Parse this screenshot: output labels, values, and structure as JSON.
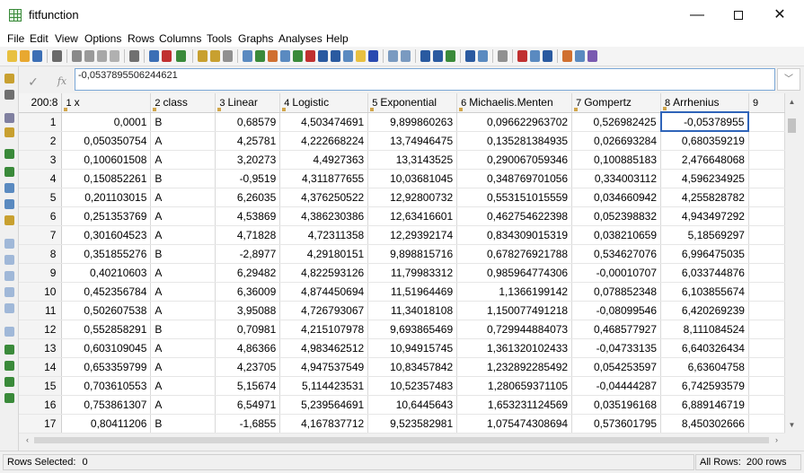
{
  "window": {
    "title": "fitfunction",
    "min_glyph": "—",
    "close_glyph": "✕"
  },
  "menu": [
    "File",
    "Edit",
    "View",
    "Options",
    "Rows",
    "Columns",
    "Tools",
    "Graphs",
    "Analyses",
    "Help"
  ],
  "formula_bar": {
    "cancel_glyph": "✓",
    "fx_label": "fx",
    "value": "-0,0537895506244621",
    "dropdown_glyph": "﹀"
  },
  "grid": {
    "corner_label": "200:8",
    "columns": [
      {
        "num": "1",
        "name": "x"
      },
      {
        "num": "2",
        "name": "class"
      },
      {
        "num": "3",
        "name": "Linear"
      },
      {
        "num": "4",
        "name": "Logistic"
      },
      {
        "num": "5",
        "name": "Exponential"
      },
      {
        "num": "6",
        "name": "Michaelis.Menten"
      },
      {
        "num": "7",
        "name": "Gompertz"
      },
      {
        "num": "8",
        "name": "Arrhenius"
      },
      {
        "num": "9",
        "name": ""
      }
    ],
    "rows": [
      [
        "1",
        "0,0001",
        "B",
        "0,68579",
        "4,503474691",
        "9,899860263",
        "0,096622963702",
        "0,526982425",
        "-0,05378955"
      ],
      [
        "2",
        "0,050350754",
        "A",
        "4,25781",
        "4,222668224",
        "13,74946475",
        "0,135281384935",
        "0,026693284",
        "0,680359219"
      ],
      [
        "3",
        "0,100601508",
        "A",
        "3,20273",
        "4,4927363",
        "13,3143525",
        "0,290067059346",
        "0,100885183",
        "2,476648068"
      ],
      [
        "4",
        "0,150852261",
        "B",
        "-0,9519",
        "4,311877655",
        "10,03681045",
        "0,348769701056",
        "0,334003112",
        "4,596234925"
      ],
      [
        "5",
        "0,201103015",
        "A",
        "6,26035",
        "4,376250522",
        "12,92800732",
        "0,553151015559",
        "0,034660942",
        "4,255828782"
      ],
      [
        "6",
        "0,251353769",
        "A",
        "4,53869",
        "4,386230386",
        "12,63416601",
        "0,462754622398",
        "0,052398832",
        "4,943497292"
      ],
      [
        "7",
        "0,301604523",
        "A",
        "4,71828",
        "4,72311358",
        "12,29392174",
        "0,834309015319",
        "0,038210659",
        "5,18569297"
      ],
      [
        "8",
        "0,351855276",
        "B",
        "-2,8977",
        "4,29180151",
        "9,898815716",
        "0,678276921788",
        "0,534627076",
        "6,996475035"
      ],
      [
        "9",
        "0,40210603",
        "A",
        "6,29482",
        "4,822593126",
        "11,79983312",
        "0,985964774306",
        "-0,00010707",
        "6,033744876"
      ],
      [
        "10",
        "0,452356784",
        "A",
        "6,36009",
        "4,874450694",
        "11,51964469",
        "1,1366199142",
        "0,078852348",
        "6,103855674"
      ],
      [
        "11",
        "0,502607538",
        "A",
        "3,95088",
        "4,726793067",
        "11,34018108",
        "1,150077491218",
        "-0,08099546",
        "6,420269239"
      ],
      [
        "12",
        "0,552858291",
        "B",
        "0,70981",
        "4,215107978",
        "9,693865469",
        "0,729944884073",
        "0,468577927",
        "8,111084524"
      ],
      [
        "13",
        "0,603109045",
        "A",
        "4,86366",
        "4,983462512",
        "10,94915745",
        "1,361320102433",
        "-0,04733135",
        "6,640326434"
      ],
      [
        "14",
        "0,653359799",
        "A",
        "4,23705",
        "4,947537549",
        "10,83457842",
        "1,232892285492",
        "0,054253597",
        "6,63604758"
      ],
      [
        "15",
        "0,703610553",
        "A",
        "5,15674",
        "5,114423531",
        "10,52357483",
        "1,280659371105",
        "-0,04444287",
        "6,742593579"
      ],
      [
        "16",
        "0,753861307",
        "A",
        "6,54971",
        "5,239564691",
        "10,6445643",
        "1,653231124569",
        "0,035196168",
        "6,889146719"
      ],
      [
        "17",
        "0,80411206",
        "B",
        "-1,6855",
        "4,167837712",
        "9,523582981",
        "1,075474308694",
        "0,573601795",
        "8,450302666"
      ]
    ]
  },
  "status": {
    "rows_selected_label": "Rows Selected:",
    "rows_selected_value": "0",
    "all_rows_label": "All Rows:",
    "all_rows_value": "200 rows"
  }
}
